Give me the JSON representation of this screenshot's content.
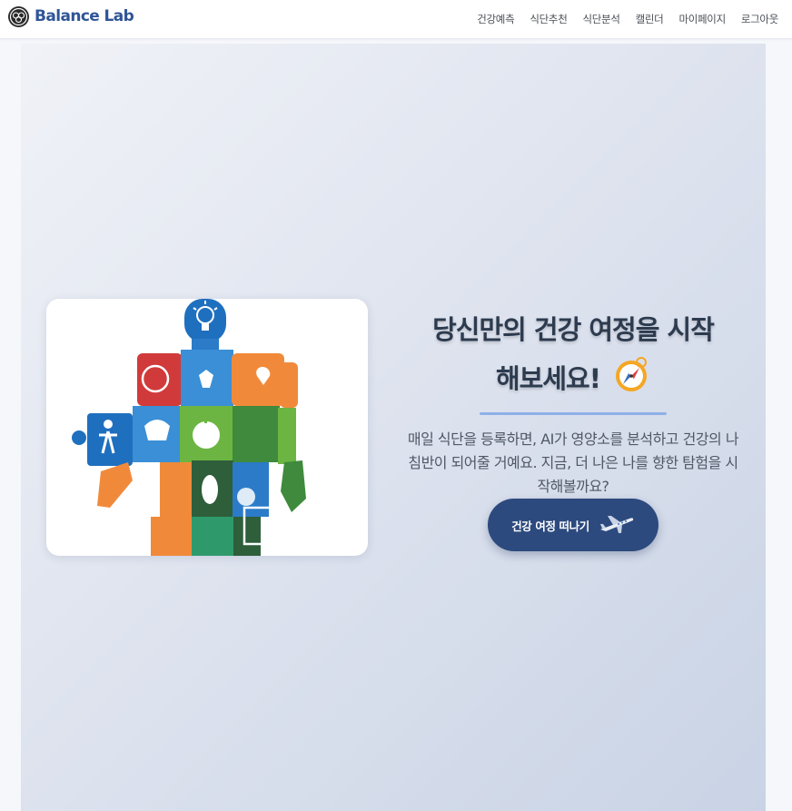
{
  "brand": {
    "name": "Balance Lab",
    "logo_icon": "brain-circles-icon"
  },
  "nav": {
    "items": [
      {
        "label": "건강예측"
      },
      {
        "label": "식단추천"
      },
      {
        "label": "식단분석"
      },
      {
        "label": "캘린더"
      },
      {
        "label": "마이페이지"
      },
      {
        "label": "로그아웃"
      }
    ]
  },
  "hero": {
    "image": {
      "icon": "health-puzzle-body-illustration"
    },
    "title_line1": "당신만의 건강 여정을 시작",
    "title_line2": "해보세요!",
    "title_icon": "compass-icon",
    "description": "매일 식단을 등록하면, AI가 영양소를 분석하고 건강의 나침반이 되어줄 거예요. 지금, 더 나은 나를 향한 탐험을 시작해볼까요?",
    "cta_label": "건강 여정 떠나기",
    "cta_icon": "airplane-icon"
  },
  "colors": {
    "brand": "#2f5597",
    "title": "#2d3b4f",
    "cta_bg": "#2c4a7e",
    "underline": "#8fb0e8"
  }
}
